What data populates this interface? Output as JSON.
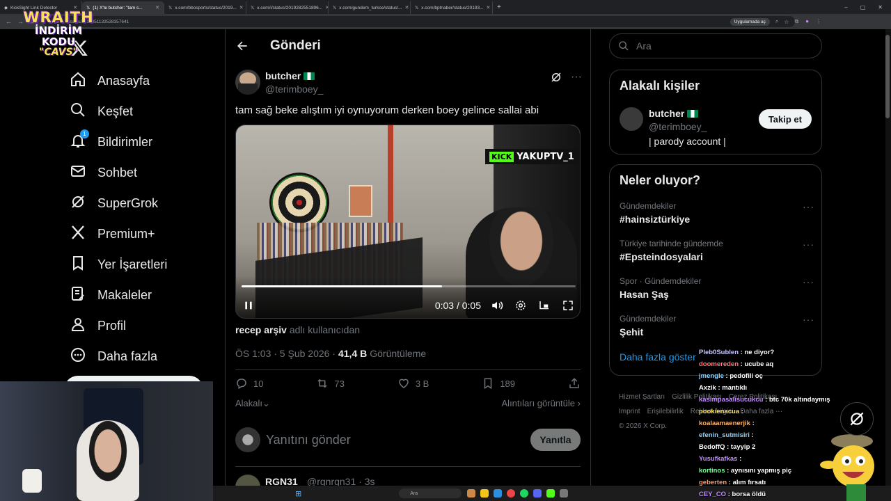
{
  "browser": {
    "tabs": [
      {
        "label": "KickSight Link Detector",
        "active": false
      },
      {
        "label": "(1) X'te butcher: \"tam s...",
        "active": true
      },
      {
        "label": "x.com/bbosports/status/2019...",
        "active": false
      },
      {
        "label": "x.com/i/status/2019282551896...",
        "active": false
      },
      {
        "label": "x.com/gundem_turkce/status/...",
        "active": false
      },
      {
        "label": "x.com/bptnaber/status/20193...",
        "active": false
      }
    ],
    "url": "x.com/.../status/2019351133538357641",
    "install_chip": "Uygulamada aç"
  },
  "overlay": {
    "line1": "WRAITH",
    "line2": "İNDİRİM KODU",
    "line3": "\"CAVS\""
  },
  "sidebar": {
    "items": [
      {
        "label": "Anasayfa",
        "icon": "home-icon"
      },
      {
        "label": "Keşfet",
        "icon": "search-icon"
      },
      {
        "label": "Bildirimler",
        "icon": "bell-icon",
        "badge": "1"
      },
      {
        "label": "Sohbet",
        "icon": "mail-icon"
      },
      {
        "label": "SuperGrok",
        "icon": "grok-icon"
      },
      {
        "label": "Premium+",
        "icon": "x-icon"
      },
      {
        "label": "Yer İşaretleri",
        "icon": "bookmark-icon"
      },
      {
        "label": "Makaleler",
        "icon": "article-icon"
      },
      {
        "label": "Profil",
        "icon": "person-icon"
      },
      {
        "label": "Daha fazla",
        "icon": "more-circle-icon"
      }
    ]
  },
  "main": {
    "title": "Gönderi",
    "post": {
      "author": "butcher",
      "handle": "@terimboey_",
      "text": "tam sağ beke alıştım iyi oynuyorum derken boey gelince sallai abi",
      "video": {
        "overlay_tag": "YAKUPTV_1",
        "kick_logo": "KICK",
        "time": "0:03 / 0:05",
        "progress": 0.6
      },
      "attribution_user": "recep arşiv",
      "attribution_suffix": "adlı kullanıcıdan",
      "timestamp": "ÖS 1:03 · 5 Şub 2026 ·",
      "views": "41,4 B",
      "views_label": "Görüntüleme",
      "stats": {
        "replies": "10",
        "reposts": "73",
        "likes": "3 B",
        "bookmarks": "189"
      },
      "sort_label": "Alakalı",
      "quotes_label": "Alıntıları görüntüle"
    },
    "reply": {
      "placeholder": "Yanıtını gönder",
      "button": "Yanıtla"
    },
    "next_reply": {
      "name": "RGN31",
      "handle": "@rgnrgn31 · 3s"
    }
  },
  "right": {
    "search_placeholder": "Ara",
    "related": {
      "title": "Alakalı kişiler",
      "name": "butcher",
      "handle": "@terimboey_",
      "bio": "| parody account |",
      "follow": "Takip et"
    },
    "trends": {
      "title": "Neler oluyor?",
      "items": [
        {
          "context": "Gündemdekiler",
          "name": "#hainsiztürkiye"
        },
        {
          "context": "Türkiye tarihinde gündemde",
          "name": "#Epsteindosyalari"
        },
        {
          "context": "Spor · Gündemdekiler",
          "name": "Hasan Şaş"
        },
        {
          "context": "Gündemdekiler",
          "name": "Şehit"
        }
      ],
      "show_more": "Daha fazla göster"
    },
    "footer": {
      "links": [
        "Hizmet Şartları",
        "Gizlilik Politikası",
        "Çerez Politikası",
        "Imprint",
        "Erişilebilirlik",
        "Reklam bilgisi",
        "Daha fazla ···",
        "© 2026 X Corp."
      ]
    }
  },
  "chat": [
    {
      "user": "Pleb0Sublen",
      "msg": ": ne diyor?",
      "color": "#c8c8ff"
    },
    {
      "user": "doomereden",
      "msg": ": ucube aq",
      "color": "#ff7b7b"
    },
    {
      "user": "jmengle",
      "msg": ": pedofili oç",
      "color": "#8fd3ff"
    },
    {
      "user": "Axzik",
      "msg": ": mantıklı",
      "color": "#ffffff"
    },
    {
      "user": "kasimpasalisucukcu",
      "msg": ": btc 70k altındaymış",
      "color": "#c38cff"
    },
    {
      "user": "pookienacua",
      "msg": ":",
      "color": "#ffe66b"
    },
    {
      "user": "koalaamaenerjik",
      "msg": ":",
      "color": "#ffb36b"
    },
    {
      "user": "efenin_sutmisiri",
      "msg": ":",
      "color": "#8fd3ff"
    },
    {
      "user": "BedoffQ",
      "msg": ": tayyip 2",
      "color": "#ffffff"
    },
    {
      "user": "Yusufkafkas",
      "msg": ":",
      "color": "#c38cff"
    },
    {
      "user": "kortinos",
      "msg": ": aynısını yapmış piç",
      "color": "#7bff9b"
    },
    {
      "user": "geberten",
      "msg": ": alım fırsatı",
      "color": "#ff9b6b"
    },
    {
      "user": "CEY_CO",
      "msg": ": borsa öldü",
      "color": "#c38cff"
    }
  ],
  "taskbar": {
    "search": "Ara"
  },
  "colors": {
    "background": "#000000",
    "text": "#e7e9ea",
    "muted": "#71767b",
    "accent": "#1d9bf0",
    "border": "#2f3336"
  }
}
